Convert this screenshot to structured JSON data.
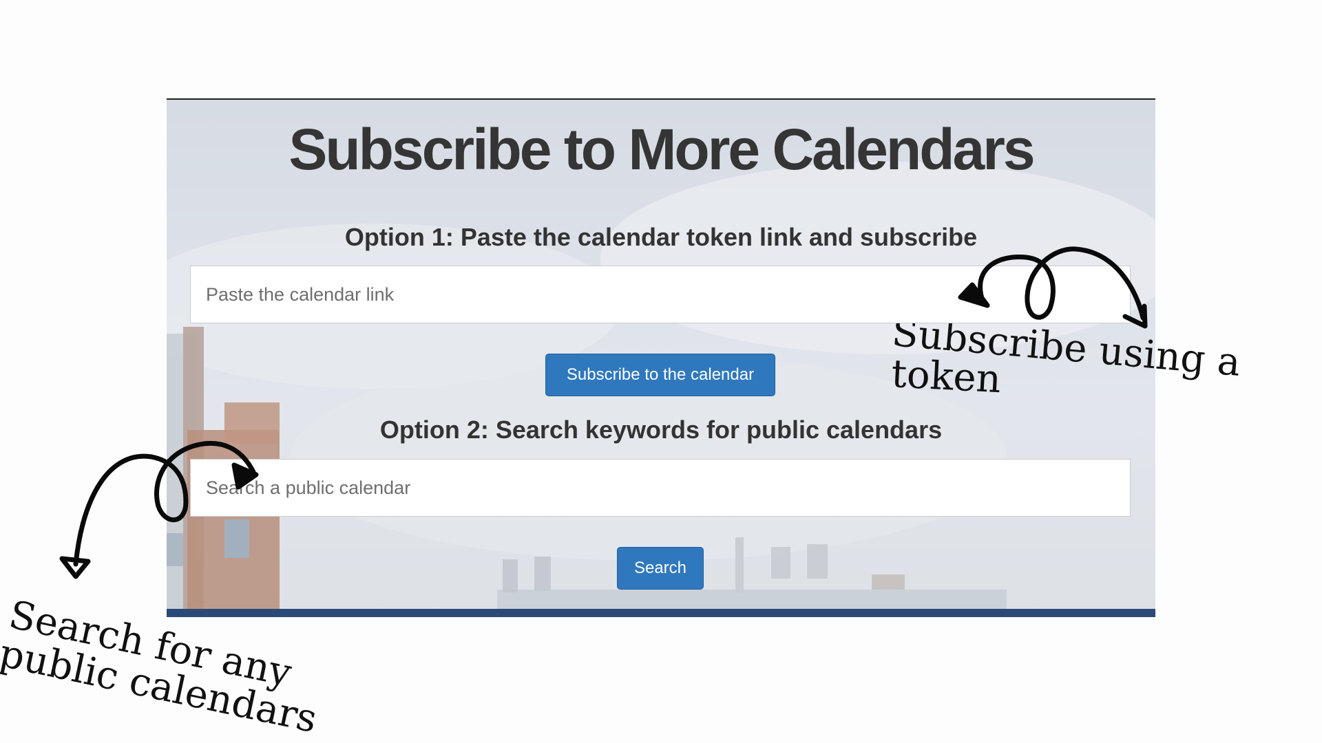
{
  "page": {
    "title": "Subscribe to More Calendars"
  },
  "option1": {
    "heading": "Option 1: Paste the calendar token link and subscribe",
    "input_placeholder": "Paste the calendar link",
    "input_value": "",
    "button_label": "Subscribe to the calendar"
  },
  "option2": {
    "heading": "Option 2: Search keywords for public calendars",
    "input_placeholder": "Search a public calendar",
    "input_value": "",
    "button_label": "Search"
  },
  "annotations": {
    "token_line1": "Subscribe using a",
    "token_line2": "token",
    "search_line1": "Search for any",
    "search_line2": "public calendars"
  },
  "colors": {
    "button": "#2f78bd",
    "bottom_bar": "#2b4a78",
    "title_text": "#353535"
  }
}
